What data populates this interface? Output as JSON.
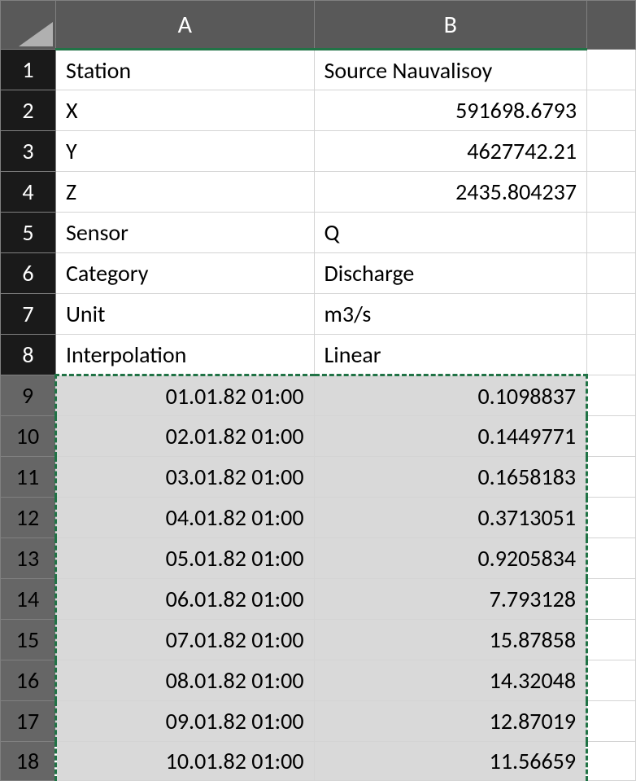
{
  "columns": {
    "a": "A",
    "b": "B"
  },
  "rowNumbers": [
    "1",
    "2",
    "3",
    "4",
    "5",
    "6",
    "7",
    "8",
    "9",
    "10",
    "11",
    "12",
    "13",
    "14",
    "15",
    "16",
    "17",
    "18"
  ],
  "headerRows": [
    {
      "label": "Station",
      "value": "Source Nauvalisoy",
      "valueAlign": "left"
    },
    {
      "label": "X",
      "value": "591698.6793",
      "valueAlign": "right"
    },
    {
      "label": "Y",
      "value": "4627742.21",
      "valueAlign": "right"
    },
    {
      "label": "Z",
      "value": "2435.804237",
      "valueAlign": "right"
    },
    {
      "label": "Sensor",
      "value": "Q",
      "valueAlign": "left"
    },
    {
      "label": "Category",
      "value": "Discharge",
      "valueAlign": "left"
    },
    {
      "label": "Unit",
      "value": "m3/s",
      "valueAlign": "left"
    },
    {
      "label": "Interpolation",
      "value": "Linear",
      "valueAlign": "left"
    }
  ],
  "dataRows": [
    {
      "date": "01.01.82 01:00",
      "value": "0.1098837"
    },
    {
      "date": "02.01.82 01:00",
      "value": "0.1449771"
    },
    {
      "date": "03.01.82 01:00",
      "value": "0.1658183"
    },
    {
      "date": "04.01.82 01:00",
      "value": "0.3713051"
    },
    {
      "date": "05.01.82 01:00",
      "value": "0.9205834"
    },
    {
      "date": "06.01.82 01:00",
      "value": "7.793128"
    },
    {
      "date": "07.01.82 01:00",
      "value": "15.87858"
    },
    {
      "date": "08.01.82 01:00",
      "value": "14.32048"
    },
    {
      "date": "09.01.82 01:00",
      "value": "12.87019"
    },
    {
      "date": "10.01.82 01:00",
      "value": "11.56659"
    }
  ]
}
